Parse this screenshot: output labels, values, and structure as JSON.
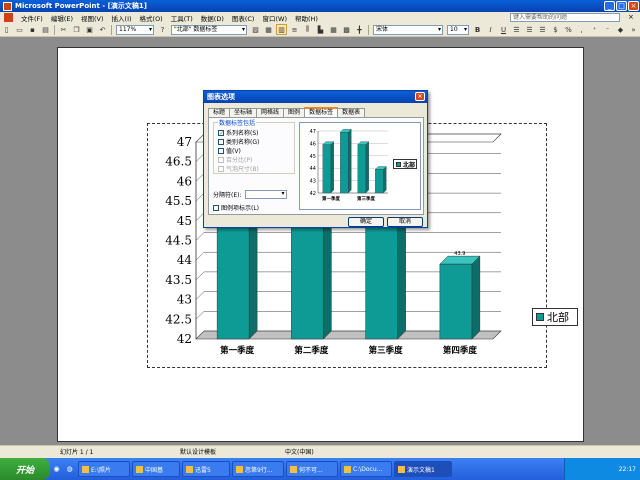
{
  "window": {
    "title": "Microsoft PowerPoint - [演示文稿1]"
  },
  "menu": {
    "items": [
      "文件(F)",
      "编辑(E)",
      "视图(V)",
      "插入(I)",
      "格式(O)",
      "工具(T)",
      "数据(D)",
      "图表(C)",
      "窗口(W)",
      "帮助(H)"
    ],
    "help_placeholder": "键入需要帮助的问题"
  },
  "toolbar": {
    "zoom": "117%",
    "series_combo": "\"北部\" 数据标签",
    "font": "宋体",
    "font_size": "10"
  },
  "chart": {
    "legend_label": "北部",
    "colors": {
      "front": "#0e9b96",
      "side": "#0b6e6a",
      "top": "#39c4bd"
    }
  },
  "chart_data": {
    "type": "bar",
    "categories": [
      "第一季度",
      "第二季度",
      "第三季度",
      "第四季度"
    ],
    "series": [
      {
        "name": "北部",
        "values": [
          45.9,
          46.9,
          45.9,
          43.9
        ]
      }
    ],
    "y_ticks": [
      "47",
      "46.5",
      "46",
      "45.5",
      "45",
      "44.5",
      "44",
      "43.5",
      "43",
      "42.5",
      "42"
    ],
    "ylim": [
      42,
      47
    ],
    "grid": true,
    "legend_position": "right",
    "visible_data_label": "43.9"
  },
  "dialog": {
    "title": "图表选项",
    "tabs": [
      "标题",
      "坐标轴",
      "网格线",
      "图例",
      "数据标签",
      "数据表"
    ],
    "active_tab": "数据标签",
    "group_title": "数据标签包括",
    "checkboxes": [
      {
        "label": "系列名称(S)",
        "checked": true,
        "disabled": false
      },
      {
        "label": "类别名称(G)",
        "checked": false,
        "disabled": false
      },
      {
        "label": "值(V)",
        "checked": false,
        "disabled": false
      },
      {
        "label": "百分比(P)",
        "checked": false,
        "disabled": true
      },
      {
        "label": "气泡尺寸(B)",
        "checked": false,
        "disabled": true
      }
    ],
    "separator_label": "分隔符(E):",
    "legend_key_label": "图例项标示(L)",
    "preview": {
      "y_ticks": [
        "47",
        "46",
        "45",
        "44",
        "43",
        "42"
      ],
      "categories": [
        "第一季度",
        "第三季度"
      ],
      "legend_label": "北部"
    },
    "ok_label": "确定",
    "cancel_label": "取消"
  },
  "statusbar": {
    "slide": "幻灯片 1 / 1",
    "template": "默认设计模板",
    "language": "中文(中国)"
  },
  "taskbar": {
    "start": "开始",
    "tasks": [
      "E:\\照片",
      "中国基",
      "迅雷5",
      "忽第9行...",
      "何不可...",
      "C:\\Docu...",
      "演示文稿1"
    ],
    "time": "22:17"
  }
}
